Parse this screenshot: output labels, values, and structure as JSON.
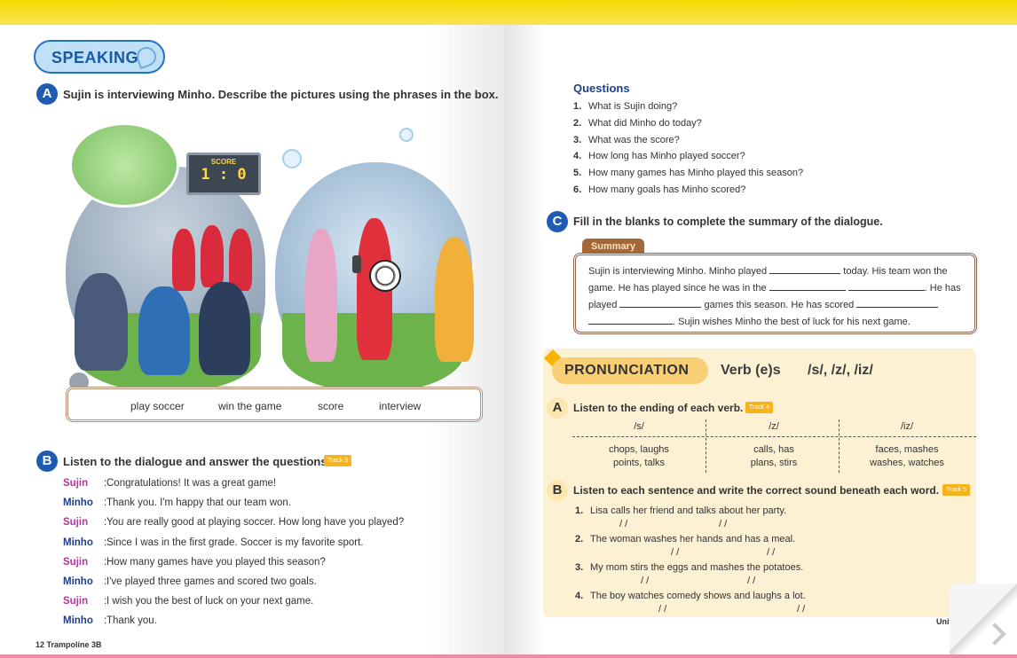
{
  "left": {
    "speaking_label": "SPEAKING",
    "section_a": {
      "letter": "A",
      "instruction": "Sujin is interviewing Minho. Describe the pictures using the phrases in the box."
    },
    "scoreboard": {
      "label": "SCORE",
      "value": "1 : 0"
    },
    "phrases": [
      "play soccer",
      "win the game",
      "score",
      "interview"
    ],
    "section_b": {
      "letter": "B",
      "instruction": "Listen to the dialogue and answer the questions.",
      "track": "Track 3"
    },
    "dialogue": [
      {
        "speaker": "Sujin",
        "text": "Congratulations! It was a great game!"
      },
      {
        "speaker": "Minho",
        "text": "Thank you. I'm happy that our team won."
      },
      {
        "speaker": "Sujin",
        "text": "You are really good at playing soccer. How long have you played?"
      },
      {
        "speaker": "Minho",
        "text": "Since I was in the first grade. Soccer is my favorite sport."
      },
      {
        "speaker": "Sujin",
        "text": "How many games have you played this season?"
      },
      {
        "speaker": "Minho",
        "text": "I've played three games and scored two goals."
      },
      {
        "speaker": "Sujin",
        "text": "I wish you the best of luck on your next game."
      },
      {
        "speaker": "Minho",
        "text": "Thank you."
      }
    ],
    "footer": "12  Trampoline 3B",
    "colors": {
      "blue": "#1f5bb0",
      "sujin": "#b8349d",
      "minho": "#1d3f8a",
      "track": "#f7b31c"
    }
  },
  "right": {
    "questions_heading": "Questions",
    "questions": [
      {
        "num": "1.",
        "text": "What is Sujin doing?"
      },
      {
        "num": "2.",
        "text": "What did Minho do today?"
      },
      {
        "num": "3.",
        "text": "What was the score?"
      },
      {
        "num": "4.",
        "text": "How long has Minho played soccer?"
      },
      {
        "num": "5.",
        "text": "How many games has Minho played this season?"
      },
      {
        "num": "6.",
        "text": "How many goals has Minho scored?"
      }
    ],
    "section_c": {
      "letter": "C",
      "instruction": "Fill in the blanks to complete the summary of the dialogue."
    },
    "summary": {
      "tab": "Summary",
      "p1": "Sujin is interviewing Minho. Minho played",
      "p2": "today. His team won the",
      "p3": "game. He has played since he was in the",
      "p4": ". He has",
      "p5": "played",
      "p6": "games this season. He has scored",
      "p7": ". Sujin wishes Minho the best of luck for his next game."
    },
    "pronunciation": {
      "label": "PRONUNCIATION",
      "title": "Verb (e)s",
      "sounds": "/s/, /z/, /iz/",
      "section_a": {
        "letter": "A",
        "instruction": "Listen to the ending of each verb.",
        "track": "Track 4"
      },
      "table": {
        "headers": [
          "/s/",
          "/z/",
          "/iz/"
        ],
        "rows1": [
          "chops, laughs",
          "calls, has",
          "faces, mashes"
        ],
        "rows2": [
          "points, talks",
          "plans, stirs",
          "washes, watches"
        ]
      },
      "section_b": {
        "letter": "B",
        "instruction": "Listen to each sentence and write the correct sound beneath each word.",
        "track": "Track 5"
      },
      "sentences": [
        {
          "num": "1.",
          "text": "Lisa calls her friend and talks about her party."
        },
        {
          "num": "2.",
          "text": "The woman washes her hands and has a meal."
        },
        {
          "num": "3.",
          "text": "My mom stirs the eggs and mashes the potatoes."
        },
        {
          "num": "4.",
          "text": "The boy watches comedy shows and laughs a lot."
        }
      ],
      "slash": "/  /"
    },
    "unit_label": "Unit 1"
  }
}
